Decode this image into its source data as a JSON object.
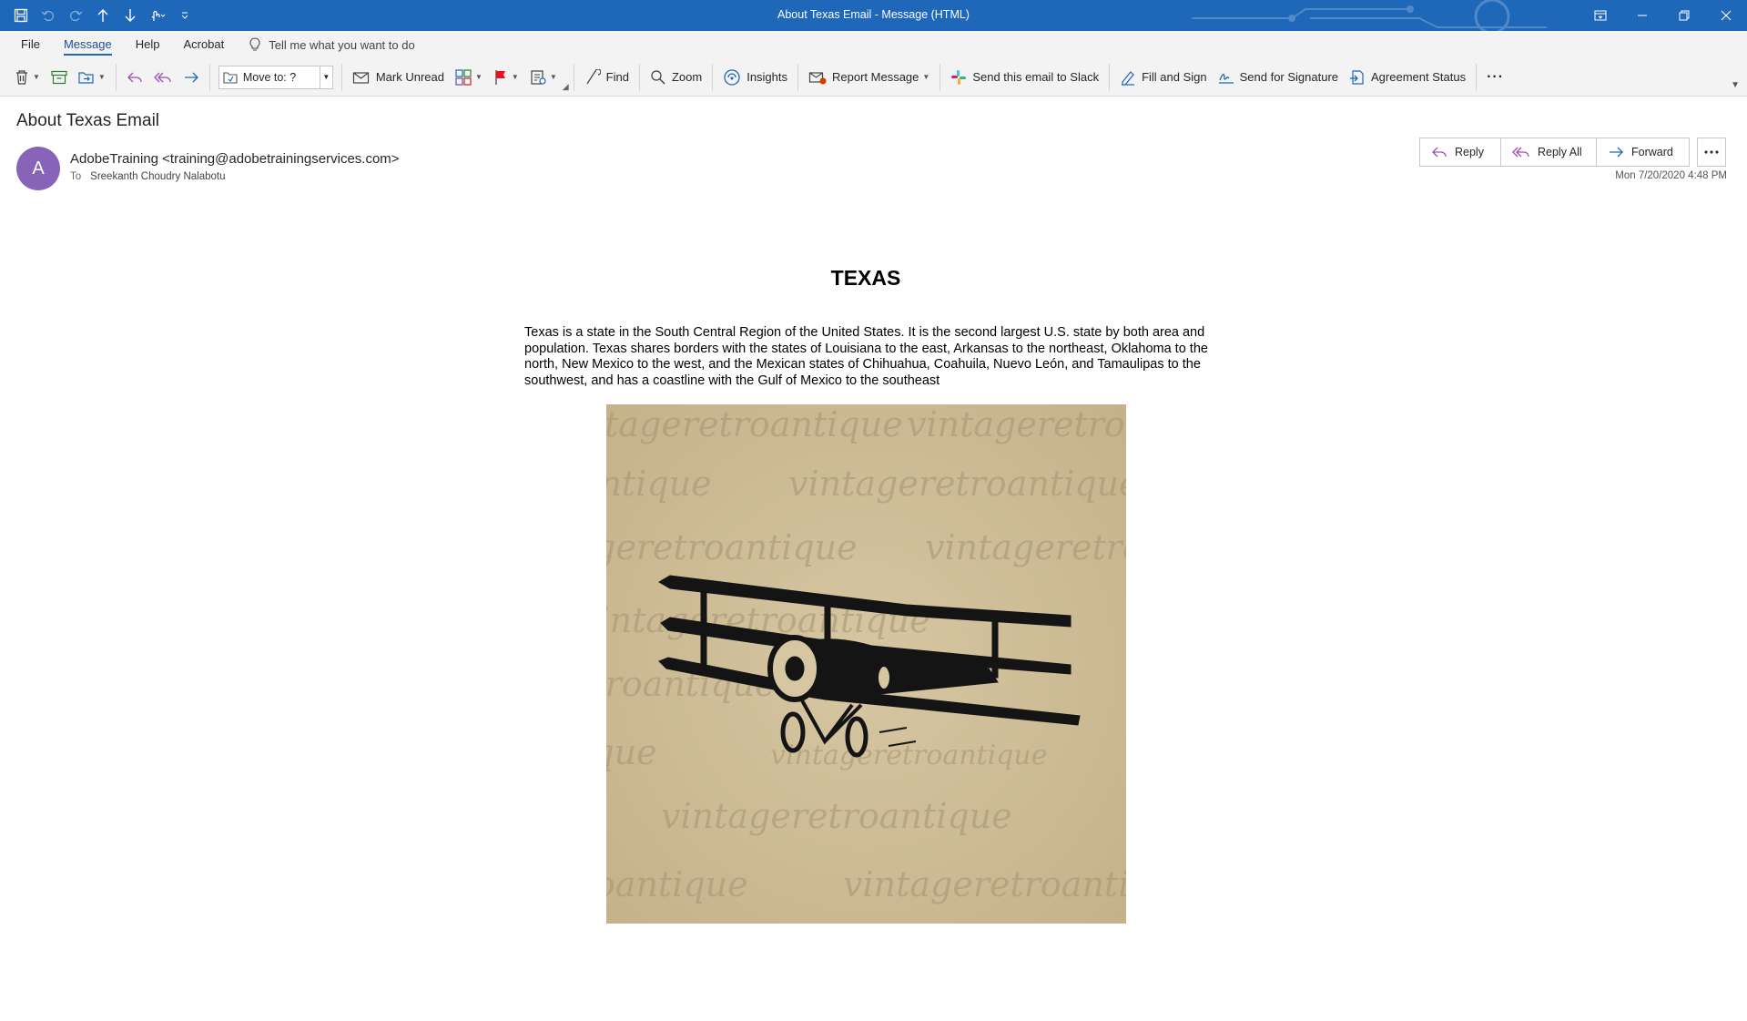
{
  "window": {
    "title": "About Texas Email  -  Message (HTML)",
    "accent": "#1e67b9"
  },
  "menu": {
    "tabs": [
      {
        "label": "File"
      },
      {
        "label": "Message",
        "active": true
      },
      {
        "label": "Help"
      },
      {
        "label": "Acrobat"
      }
    ],
    "tell_me": "Tell me what you want to do"
  },
  "ribbon": {
    "move_to": "Move to: ?",
    "mark_unread": "Mark Unread",
    "find": "Find",
    "zoom": "Zoom",
    "insights": "Insights",
    "report_message": "Report Message",
    "send_to_slack": "Send this email to Slack",
    "fill_and_sign": "Fill and Sign",
    "send_for_signature": "Send for Signature",
    "agreement_status": "Agreement Status",
    "more": "···"
  },
  "message": {
    "subject": "About Texas Email",
    "avatar_initial": "A",
    "avatar_color": "#8764b8",
    "from": "AdobeTraining <training@adobetrainingservices.com>",
    "to_label": "To",
    "to": "Sreekanth Choudry Nalabotu",
    "date": "Mon 7/20/2020 4:48 PM",
    "actions": {
      "reply": "Reply",
      "reply_all": "Reply All",
      "forward": "Forward"
    }
  },
  "content": {
    "heading": "TEXAS",
    "paragraph": "Texas is a state in the South Central Region of the United States. It is the second largest U.S. state by both area and population. Texas shares borders with the states of Louisiana to the east, Arkansas to the northeast, Oklahoma to the north, New Mexico to the west, and the Mexican states of Chihuahua, Coahuila, Nuevo León, and Tamaulipas to the southwest, and has a coastline with the Gulf of Mexico to the southeast",
    "image_watermark": "vintageretroantique"
  }
}
